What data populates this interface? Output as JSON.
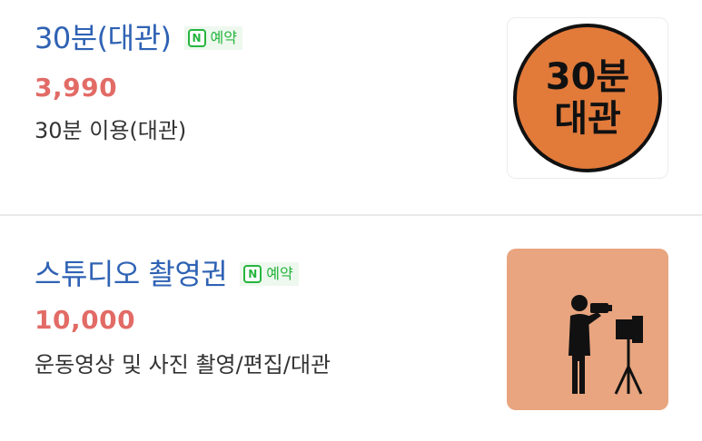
{
  "items": [
    {
      "title": "30분(대관)",
      "badge": {
        "icon_letter": "N",
        "label": "예약",
        "icon": "naver-icon"
      },
      "price": "3,990",
      "description": "30분 이용(대관)",
      "thumbnail": {
        "type": "text-circle",
        "line1": "30분",
        "line2": "대관",
        "bg_color": "#e27a3a"
      }
    },
    {
      "title": "스튜디오 촬영권",
      "badge": {
        "icon_letter": "N",
        "label": "예약",
        "icon": "naver-icon"
      },
      "price": "10,000",
      "description": "운동영상 및 사진 촬영/편집/대관",
      "thumbnail": {
        "type": "photographer-icon",
        "icon": "photographer-with-light-icon",
        "bg_color": "#e8a57f"
      }
    }
  ],
  "colors": {
    "title": "#2f62b4",
    "price": "#e26b66",
    "badge_green": "#25b53e"
  }
}
